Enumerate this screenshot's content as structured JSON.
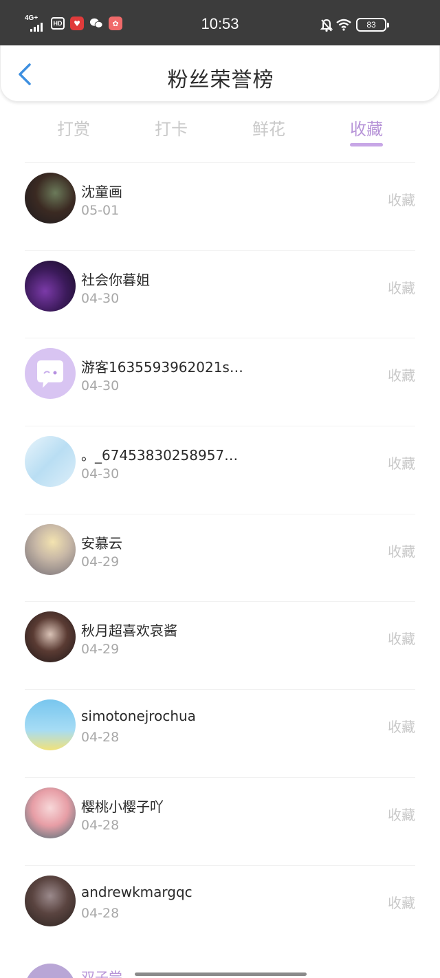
{
  "status_bar": {
    "network": "4G+",
    "hd_label": "HD",
    "time": "10:53",
    "battery": "83",
    "icons": [
      "signal-icon",
      "hd-icon",
      "app-icon-1",
      "wechat-icon",
      "app-icon-2",
      "mute-icon",
      "wifi-icon",
      "battery-icon"
    ]
  },
  "header": {
    "title": "粉丝荣誉榜",
    "back_icon": "chevron-left-icon"
  },
  "tabs": [
    {
      "label": "打赏",
      "active": false
    },
    {
      "label": "打卡",
      "active": false
    },
    {
      "label": "鲜花",
      "active": false
    },
    {
      "label": "收藏",
      "active": true
    }
  ],
  "list": [
    {
      "name": "沈童画",
      "date": "05-01",
      "action": "收藏"
    },
    {
      "name": "社会你暮姐",
      "date": "04-30",
      "action": "收藏"
    },
    {
      "name": "游客1635593962021s…",
      "date": "04-30",
      "action": "收藏"
    },
    {
      "name": "。_67453830258957…",
      "date": "04-30",
      "action": "收藏"
    },
    {
      "name": "安慕云",
      "date": "04-29",
      "action": "收藏"
    },
    {
      "name": "秋月超喜欢哀酱",
      "date": "04-29",
      "action": "收藏"
    },
    {
      "name": "simotonejrochua",
      "date": "04-28",
      "action": "收藏"
    },
    {
      "name": "樱桃小樱子吖",
      "date": "04-28",
      "action": "收藏"
    },
    {
      "name": "andrewkmargqc",
      "date": "04-28",
      "action": "收藏"
    }
  ],
  "partial_item": {
    "name": "双子尝"
  },
  "colors": {
    "accent": "#b794d8",
    "tab_inactive": "#c9c9c9",
    "status_bar_bg": "#3c3c3c",
    "back_icon": "#3d8fe0"
  }
}
